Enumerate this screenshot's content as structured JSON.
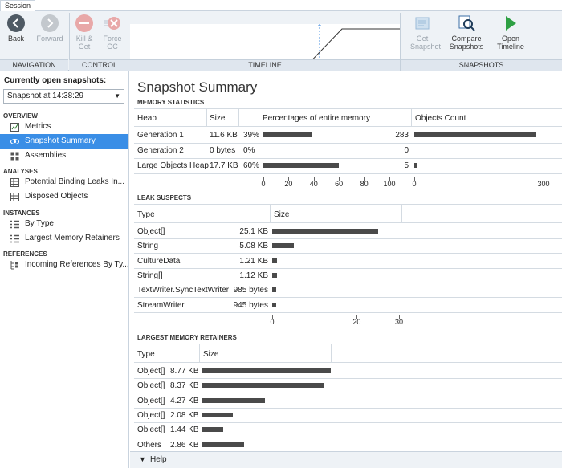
{
  "ribbon": {
    "tab": "Session",
    "buttons": {
      "back": "Back",
      "forward": "Forward",
      "kill": "Kill & Get",
      "force_gc": "Force GC",
      "get_snapshot": "Get Snapshot",
      "compare": "Compare Snapshots",
      "open_timeline": "Open Timeline"
    },
    "groups": {
      "navigation": "NAVIGATION",
      "control": "CONTROL",
      "timeline": "TIMELINE",
      "snapshots": "SNAPSHOTS"
    }
  },
  "sidebar": {
    "title": "Currently open snapshots:",
    "selected_snapshot": "Snapshot at 14:38:29",
    "sections": {
      "overview": "OVERVIEW",
      "analyses": "ANALYSES",
      "instances": "INSTANCES",
      "references": "REFERENCES"
    },
    "items": {
      "metrics": "Metrics",
      "snapshot_summary": "Snapshot Summary",
      "assemblies": "Assemblies",
      "binding_leaks": "Potential Binding Leaks In...",
      "disposed": "Disposed Objects",
      "by_type": "By Type",
      "largest_retainers": "Largest Memory Retainers",
      "incoming_refs": "Incoming References By Ty..."
    }
  },
  "main": {
    "title": "Snapshot Summary",
    "memory_statistics": {
      "heading": "MEMORY STATISTICS",
      "columns": [
        "Heap",
        "Size",
        "Percentages of entire memory",
        "Objects Count"
      ],
      "rows": [
        {
          "heap": "Generation 1",
          "size": "11.6 KB",
          "percent_label": "39%",
          "percent": 39,
          "count_label": "283",
          "count": 283
        },
        {
          "heap": "Generation 2",
          "size": "0 bytes",
          "percent_label": "0%",
          "percent": 0,
          "count_label": "0",
          "count": 0
        },
        {
          "heap": "Large Objects Heap",
          "size": "17.7 KB",
          "percent_label": "60%",
          "percent": 60,
          "count_label": "5",
          "count": 5
        }
      ],
      "pct_axis": [
        "0",
        "20",
        "40",
        "60",
        "80",
        "100"
      ],
      "count_axis": [
        "0",
        "300"
      ]
    },
    "leak_suspects": {
      "heading": "LEAK SUSPECTS",
      "columns": [
        "Type",
        "Size"
      ],
      "rows": [
        {
          "type": "Object[]",
          "size": "25.1 KB",
          "kb": 25.1
        },
        {
          "type": "String",
          "size": "5.08 KB",
          "kb": 5.08
        },
        {
          "type": "CultureData",
          "size": "1.21 KB",
          "kb": 1.21
        },
        {
          "type": "String[]",
          "size": "1.12 KB",
          "kb": 1.12
        },
        {
          "type": "TextWriter.SyncTextWriter",
          "size": "985 bytes",
          "kb": 0.985
        },
        {
          "type": "StreamWriter",
          "size": "945 bytes",
          "kb": 0.945
        }
      ],
      "axis": [
        "0",
        "20",
        "30"
      ]
    },
    "largest_retainers": {
      "heading": "LARGEST MEMORY RETAINERS",
      "columns": [
        "Type",
        "Size"
      ],
      "rows": [
        {
          "type": "Object[]",
          "size": "8.77 KB",
          "kb": 8.77
        },
        {
          "type": "Object[]",
          "size": "8.37 KB",
          "kb": 8.37
        },
        {
          "type": "Object[]",
          "size": "4.27 KB",
          "kb": 4.27
        },
        {
          "type": "Object[]",
          "size": "2.08 KB",
          "kb": 2.08
        },
        {
          "type": "Object[]",
          "size": "1.44 KB",
          "kb": 1.44
        },
        {
          "type": "Others",
          "size": "2.86 KB",
          "kb": 2.86
        }
      ]
    },
    "help": "Help"
  }
}
